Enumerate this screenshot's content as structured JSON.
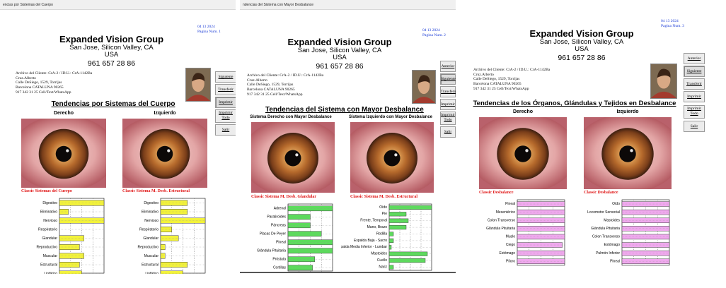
{
  "company": {
    "name": "Expanded Vision Group",
    "address": "San Jose, Silicon Valley, CA",
    "country": "USA",
    "phone": "961 657 28 86"
  },
  "client": {
    "archive": "Archivo del Cliente: CrA-2 / ID.U.: CrA-1142Ba",
    "name": "Cruz.Alberto",
    "street": "Calle DeSiego, 1529, Torrijas",
    "city": "Barcelona CATALUNA 90265",
    "contact": "917 342 31 25 Cell/Text/WhatsApp"
  },
  "date": "04 13 2024",
  "colors": {
    "yellow": "#f2f23a",
    "green": "#5bdc5b",
    "pink": "#f0a8ee",
    "red": "#e01818",
    "blue": "#1a3bd6"
  },
  "pages": [
    {
      "window_title": "encias por Sistemas del Cuerpo",
      "page_num": "Pagina Num. 1",
      "section_title": "Tendencias por Sistemas del Cuerpo",
      "left_head": "Derecho",
      "right_head": "Izquierdo",
      "left_chart_title": "Classic Sistemas del Cuerpo",
      "right_chart_title": "Classic Sistema M. Desb. Estructural",
      "buttons": [
        "Siguiente",
        "Transferir",
        "Imprimir",
        "Imprimir Todo",
        "Salir"
      ]
    },
    {
      "window_title": "ndencias del Sistema con Mayor Desbalance",
      "page_num": "Pagina Num. 2",
      "section_title": "Tendencias del Sistema con Mayor Desbalance",
      "left_head": "Sistema Derecho con Mayor Desbalance",
      "right_head": "Sistema Izquierdo con Mayor Desbalance",
      "left_chart_title": "Classic Sistema M. Desb. Glandular",
      "right_chart_title": "Classic Sistema M. Desb. Estructural",
      "buttons": [
        "Anterior",
        "Siguiente",
        "Transferir",
        "Imprimir",
        "Imprimir Todo",
        "Salir"
      ]
    },
    {
      "window_title": "",
      "page_num": "Pagina Num. 3",
      "section_title": "Tendencias de los Órganos, Glándulas y Tejidos en Desbalance",
      "left_head": "Derecho",
      "right_head": "Izquierdo",
      "left_chart_title": "Classic Desbalance",
      "right_chart_title": "Classic Desbalance",
      "buttons": [
        "Anterior",
        "Siguiente",
        "Transferir",
        "Imprimir",
        "Imprimir Todo",
        "Salir"
      ]
    }
  ],
  "chart_data": [
    {
      "type": "bar",
      "title": "Classic Sistemas del Cuerpo",
      "categories": [
        "Digestivo",
        "Eliminativo",
        "Nervioso",
        "Respiratorio",
        "Glandular",
        "Reproductivo",
        "Muscular",
        "Estructural",
        "Linfático"
      ],
      "values": [
        100,
        20,
        100,
        0,
        55,
        45,
        55,
        45,
        50
      ],
      "xlim": [
        0,
        100
      ],
      "color": "#f2f23a"
    },
    {
      "type": "bar",
      "title": "Classic Sistema M. Desb. Estructural",
      "categories": [
        "Digestivo",
        "Eliminativo",
        "Nervioso",
        "Respiratorio",
        "Glandular",
        "Reproductivo",
        "Muscular",
        "Estructural",
        "Linfático"
      ],
      "values": [
        60,
        60,
        100,
        25,
        40,
        10,
        10,
        60,
        50
      ],
      "xlim": [
        0,
        100
      ],
      "color": "#f2f23a"
    },
    {
      "type": "bar",
      "title": "Classic Sistema M. Desb. Glandular",
      "categories": [
        "Adrenal",
        "Paratiroides",
        "Páncreas",
        "Placas De Peyer",
        "Pineal",
        "Glándula Pituitaria",
        "Próstata",
        "Cortillas"
      ],
      "values": [
        100,
        50,
        50,
        75,
        100,
        100,
        60,
        55
      ],
      "xlim": [
        0,
        100
      ],
      "color": "#5bdc5b"
    },
    {
      "type": "bar",
      "title": "Classic Sistema M. Desb. Estructural",
      "categories": [
        "Oído",
        "Pie",
        "Frente, Temporal",
        "Mano, Brazo",
        "Rodilla",
        "Espalda Baja - Sacro",
        "Espalda Media Inferior - Lumbar",
        "Mastoides",
        "Cuello",
        "Nariz"
      ],
      "values": [
        100,
        40,
        45,
        40,
        10,
        10,
        5,
        90,
        85,
        10
      ],
      "xlim": [
        0,
        100
      ],
      "color": "#5bdc5b"
    },
    {
      "type": "bar",
      "title": "Classic Desbalance",
      "categories": [
        "Pineal",
        "Mesentérico",
        "Colon Transverso",
        "Glándula Pituitaria",
        "Muslo",
        "Ciego",
        "Estómago",
        "Píloro"
      ],
      "values": [
        100,
        100,
        100,
        100,
        100,
        95,
        100,
        100
      ],
      "xlim": [
        0,
        100
      ],
      "color": "#f0a8ee"
    },
    {
      "type": "bar",
      "title": "Classic Desbalance",
      "categories": [
        "Oído",
        "Locomotor Sensorial",
        "Mastoides",
        "Glándula Pituitaria",
        "Colon Transverso",
        "Estómago",
        "Pulmón Inferior",
        "Pineal"
      ],
      "values": [
        100,
        100,
        100,
        100,
        100,
        100,
        100,
        100
      ],
      "xlim": [
        0,
        100
      ],
      "color": "#f0a8ee"
    }
  ]
}
